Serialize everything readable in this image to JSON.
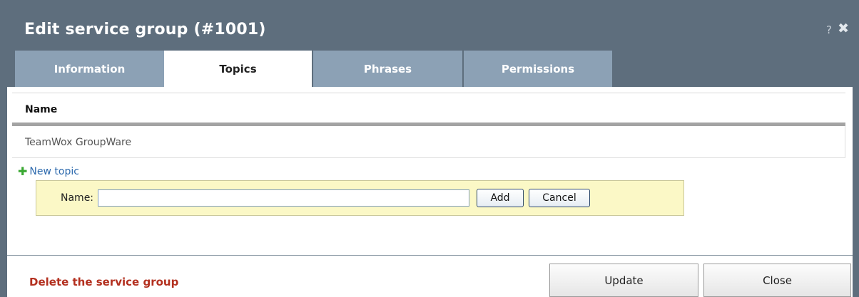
{
  "dialog": {
    "title": "Edit service group (#1001)",
    "help": "?",
    "close": "✖"
  },
  "tabs": [
    {
      "label": "Information",
      "active": false
    },
    {
      "label": "Topics",
      "active": true
    },
    {
      "label": "Phrases",
      "active": false
    },
    {
      "label": "Permissions",
      "active": false
    }
  ],
  "topics": {
    "column_header": "Name",
    "rows": [
      "TeamWox GroupWare"
    ],
    "new_topic_label": "New topic",
    "form": {
      "name_label": "Name:",
      "name_value": "",
      "add_label": "Add",
      "cancel_label": "Cancel"
    }
  },
  "footer": {
    "delete_label": "Delete the service group",
    "update_label": "Update",
    "close_label": "Close"
  },
  "colors": {
    "titlebar": "#5e6e7d",
    "tab_inactive": "#8ca1b5",
    "link": "#2c69ad",
    "danger": "#b3301f",
    "form_bg": "#fbf8c6"
  },
  "icons": {
    "new_topic": "plus-icon",
    "close": "close-icon",
    "help": "help-icon"
  }
}
